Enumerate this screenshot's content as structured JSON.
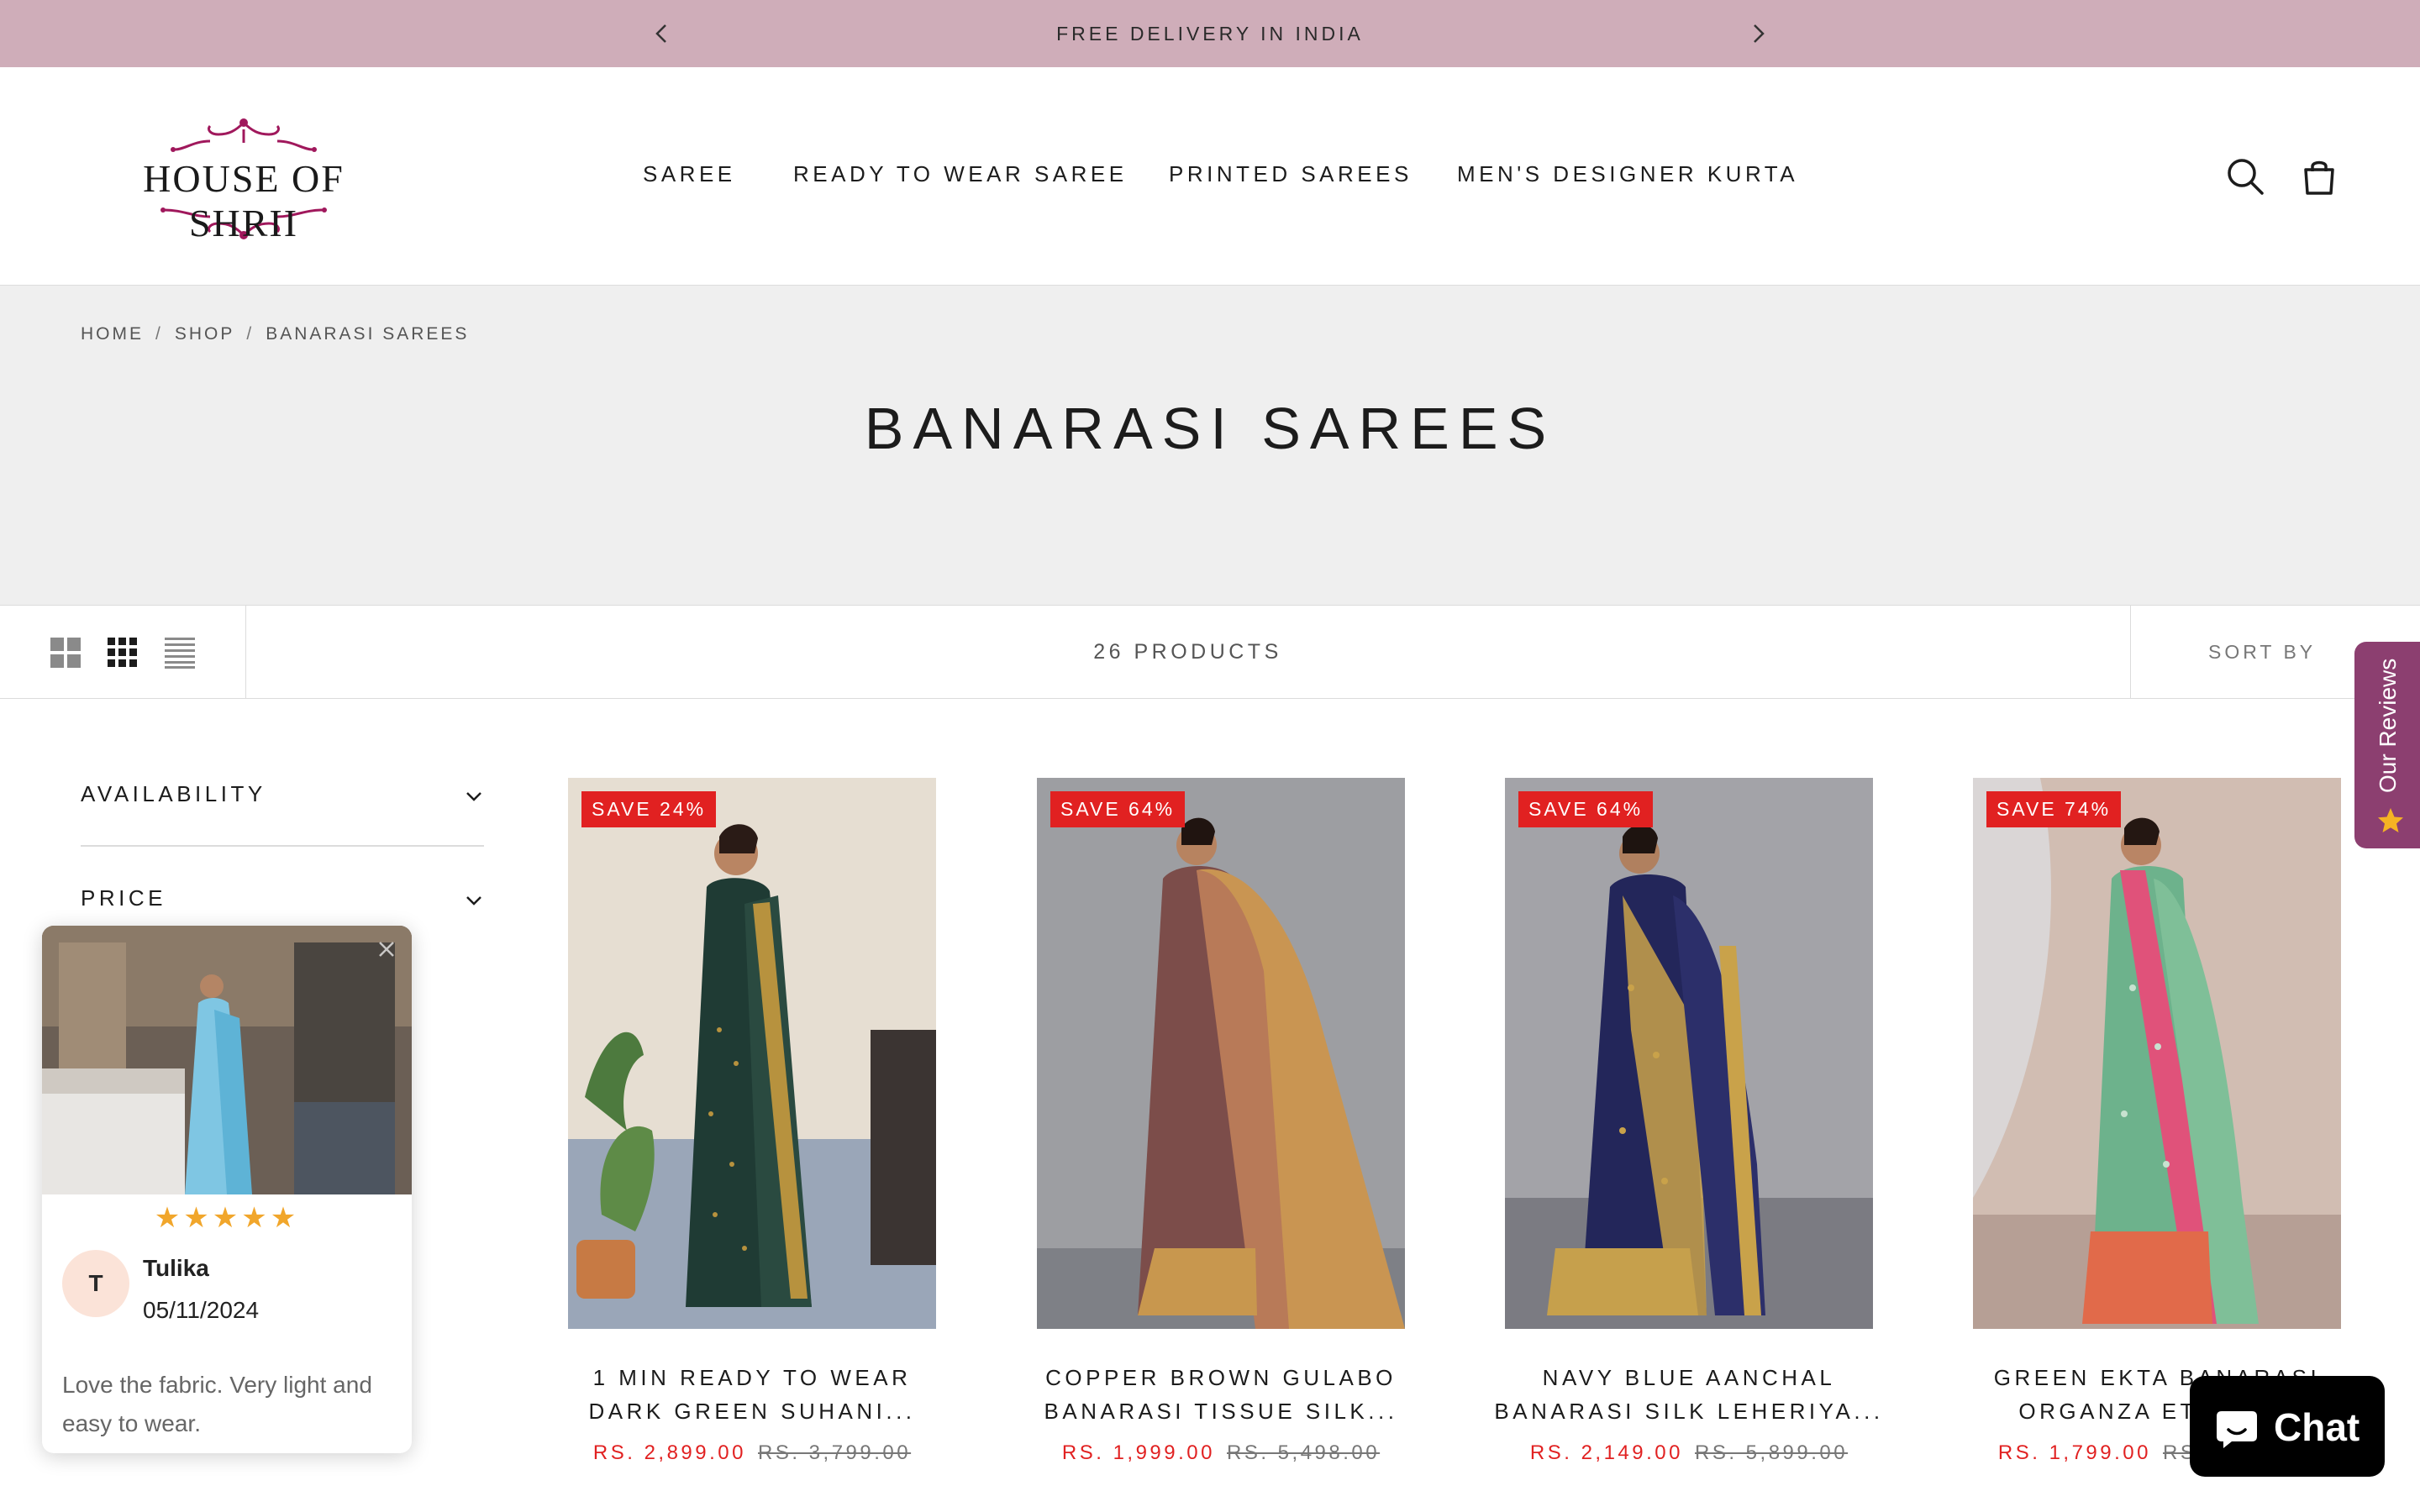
{
  "announcement": {
    "text": "FREE DELIVERY IN INDIA"
  },
  "header": {
    "logo_text": "HOUSE OF SHRII",
    "nav": [
      "SAREE",
      "READY TO WEAR SAREE",
      "PRINTED SAREES",
      "MEN'S DESIGNER KURTA"
    ],
    "icons": [
      "search-icon",
      "shopping-bag-icon"
    ]
  },
  "breadcrumb": [
    "HOME",
    "SHOP",
    "BANARASI SAREES"
  ],
  "collection": {
    "title": "BANARASI SAREES",
    "product_count": "26 PRODUCTS",
    "sort_label": "SORT BY"
  },
  "filters": [
    "AVAILABILITY",
    "PRICE"
  ],
  "products": [
    {
      "badge": "SAVE 24%",
      "title_line1": "1 MIN READY TO WEAR",
      "title_line2": "DARK GREEN SUHANI...",
      "price": "RS. 2,899.00",
      "compare_price": "RS. 3,799.00"
    },
    {
      "badge": "SAVE 64%",
      "title_line1": "COPPER BROWN GULABO",
      "title_line2": "BANARASI TISSUE SILK...",
      "price": "RS. 1,999.00",
      "compare_price": "RS. 5,498.00"
    },
    {
      "badge": "SAVE 64%",
      "title_line1": "NAVY BLUE AANCHAL",
      "title_line2": "BANARASI SILK LEHERIYA...",
      "price": "RS. 2,149.00",
      "compare_price": "RS. 5,899.00"
    },
    {
      "badge": "SAVE 74%",
      "title_line1": "GREEN EKTA BANARASI",
      "title_line2": "ORGANZA ETHNIC...",
      "price": "RS. 1,799.00",
      "compare_price": "RS. 6,999.00"
    }
  ],
  "review_popup": {
    "rating": 5,
    "stars": "★★★★★",
    "avatar_initial": "T",
    "name": "Tulika",
    "date": "05/11/2024",
    "text": "Love the fabric. Very light and easy to wear."
  },
  "side_tab": {
    "label": "Our Reviews"
  },
  "chat": {
    "label": "Chat"
  },
  "colors": {
    "announcement_bg": "#cfadb9",
    "sale_red": "#e12121",
    "hero_bg": "#efefef",
    "reviews_tab": "#8c3f70",
    "logo_magenta": "#a0185c"
  }
}
